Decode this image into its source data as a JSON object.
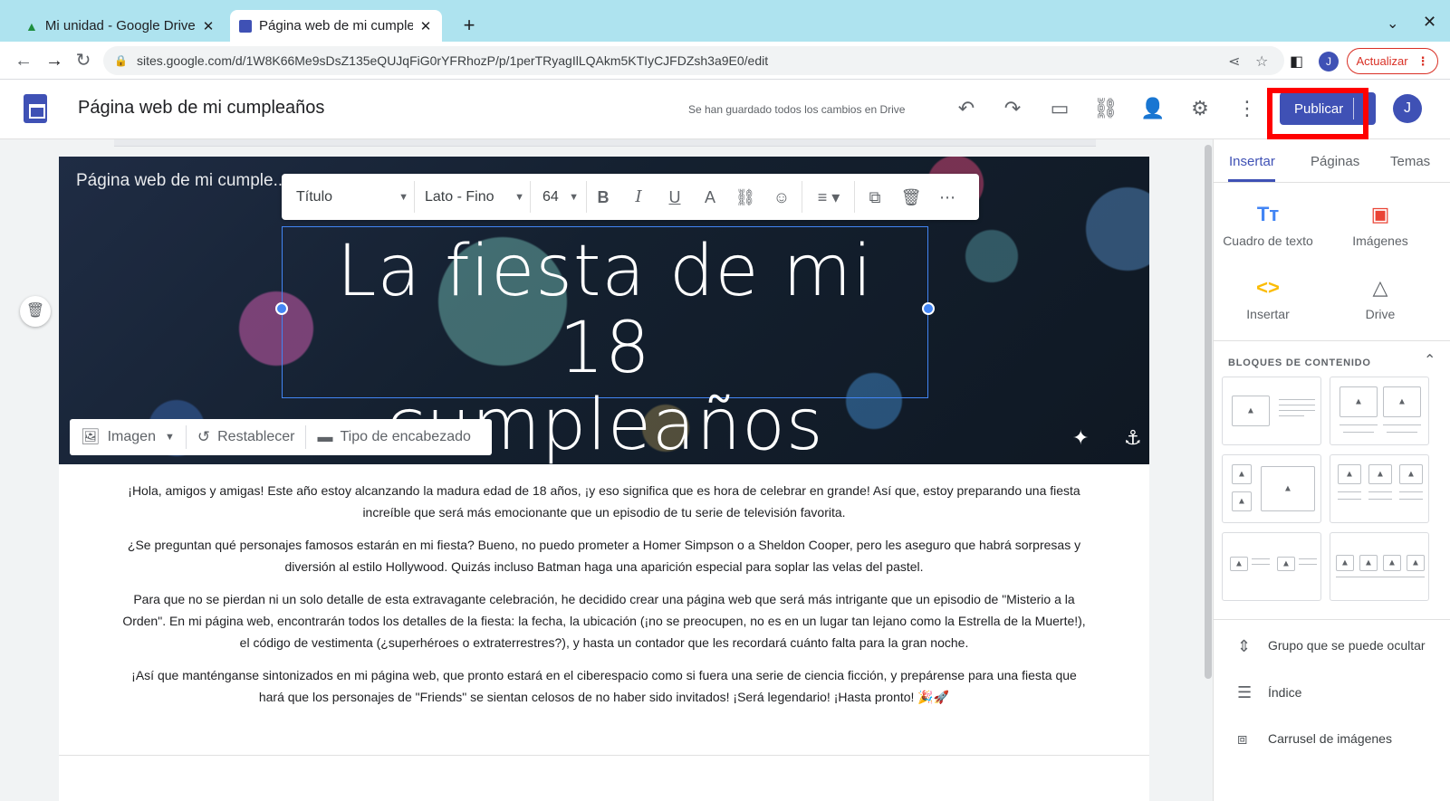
{
  "browser": {
    "tabs": [
      {
        "title": "Mi unidad - Google Drive",
        "icon": "drive-icon"
      },
      {
        "title": "Página web de mi cumple",
        "icon": "sites-icon"
      }
    ],
    "url": "sites.google.com/d/1W8K66Me9sDsZ135eQUJqFiG0rYFRhozP/p/1perTRyagIlLQAkm5KTIyCJFDZsh3a9E0/edit",
    "profile_initial": "J",
    "update_label": "Actualizar"
  },
  "header": {
    "doc_title": "Página web de mi cumpleaños",
    "save_status": "Se han guardado todos los cambios en Drive",
    "publish_label": "Publicar",
    "avatar_initial": "J"
  },
  "banner": {
    "site_name": "Página web de mi cumple...",
    "title_line1": "La fiesta de mi 18",
    "title_line2": "cumpleaños",
    "format_toolbar": {
      "style": "Título",
      "font": "Lato - Fino",
      "size": "64"
    },
    "controls": {
      "image": "Imagen",
      "reset": "Restablecer",
      "header_type": "Tipo de encabezado"
    }
  },
  "content": {
    "paragraphs": [
      "¡Hola, amigos y amigas! Este año estoy alcanzando la madura edad de 18 años, ¡y eso significa que es hora de celebrar en grande! Así que, estoy preparando una fiesta increíble que será más emocionante que un episodio de tu serie de televisión favorita.",
      "¿Se preguntan qué personajes famosos estarán en mi fiesta? Bueno, no puedo prometer a Homer Simpson o a Sheldon Cooper, pero les aseguro que habrá sorpresas y diversión al estilo Hollywood. Quizás incluso Batman haga una aparición especial para soplar las velas del pastel.",
      "Para que no se pierdan ni un solo detalle de esta extravagante celebración, he decidido crear una página web que será más intrigante que un episodio de \"Misterio a la Orden\". En mi página web, encontrarán todos los detalles de la fiesta: la fecha, la ubicación (¡no se preocupen, no es en un lugar tan lejano como la Estrella de la Muerte!), el código de vestimenta (¿superhéroes o extraterrestres?), y hasta un contador que les recordará cuánto falta para la gran noche.",
      "¡Así que manténganse sintonizados en mi página web, que pronto estará en el ciberespacio como si fuera una serie de ciencia ficción, y prepárense para una fiesta que hará que los personajes de \"Friends\" se sientan celosos de no haber sido invitados! ¡Será legendario! ¡Hasta pronto! 🎉🚀"
    ]
  },
  "panel": {
    "tabs": [
      "Insertar",
      "Páginas",
      "Temas"
    ],
    "insert_items": [
      {
        "label": "Cuadro de texto",
        "icon": "text-box-icon",
        "color": "#4285f4"
      },
      {
        "label": "Imágenes",
        "icon": "image-icon",
        "color": "#ea4335"
      },
      {
        "label": "Insertar",
        "icon": "embed-icon",
        "color": "#fbbc04"
      },
      {
        "label": "Drive",
        "icon": "drive-icon",
        "color": "#5f6368"
      }
    ],
    "blocks_header": "BLOQUES DE CONTENIDO",
    "list_items": [
      "Grupo que se puede ocultar",
      "Índice",
      "Carrusel de imágenes"
    ]
  },
  "colors": {
    "accent": "#3f51b5",
    "highlight": "#ff0000",
    "selection": "#4285f4"
  }
}
